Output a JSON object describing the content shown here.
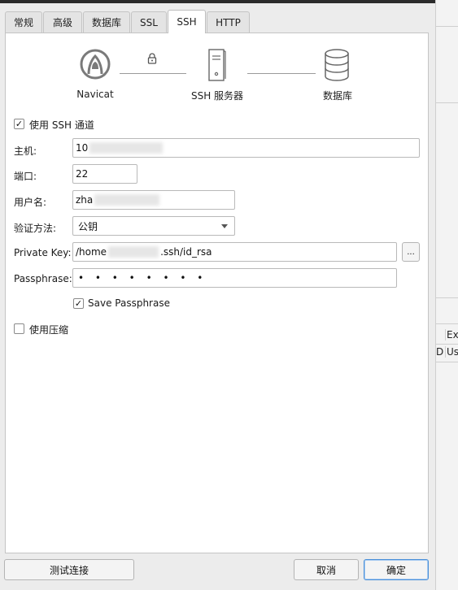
{
  "tabs": [
    "常规",
    "高级",
    "数据库",
    "SSL",
    "SSH",
    "HTTP"
  ],
  "active_tab": "SSH",
  "diagram": {
    "client_label": "Navicat",
    "server_label": "SSH 服务器",
    "db_label": "数据库"
  },
  "form": {
    "use_ssh_label": "使用 SSH 通道",
    "use_ssh_checked": "✓",
    "host_label": "主机:",
    "host_value": "10",
    "port_label": "端口:",
    "port_value": "22",
    "username_label": "用户名:",
    "username_value": "zha",
    "auth_label": "验证方法:",
    "auth_value": "公钥",
    "private_key_label": "Private Key:",
    "private_key_prefix": "/home",
    "private_key_suffix": ".ssh/id_rsa",
    "browse_label": "...",
    "passphrase_label": "Passphrase:",
    "passphrase_value": "• • • • • • • •",
    "save_passphrase_label": "Save Passphrase",
    "save_passphrase_checked": "✓",
    "compress_label": "使用压缩"
  },
  "buttons": {
    "test": "测试连接",
    "cancel": "取消",
    "ok": "确定"
  },
  "background": {
    "col_header": "Ext",
    "col_cell_a": "D",
    "col_cell_b": "Usi"
  }
}
